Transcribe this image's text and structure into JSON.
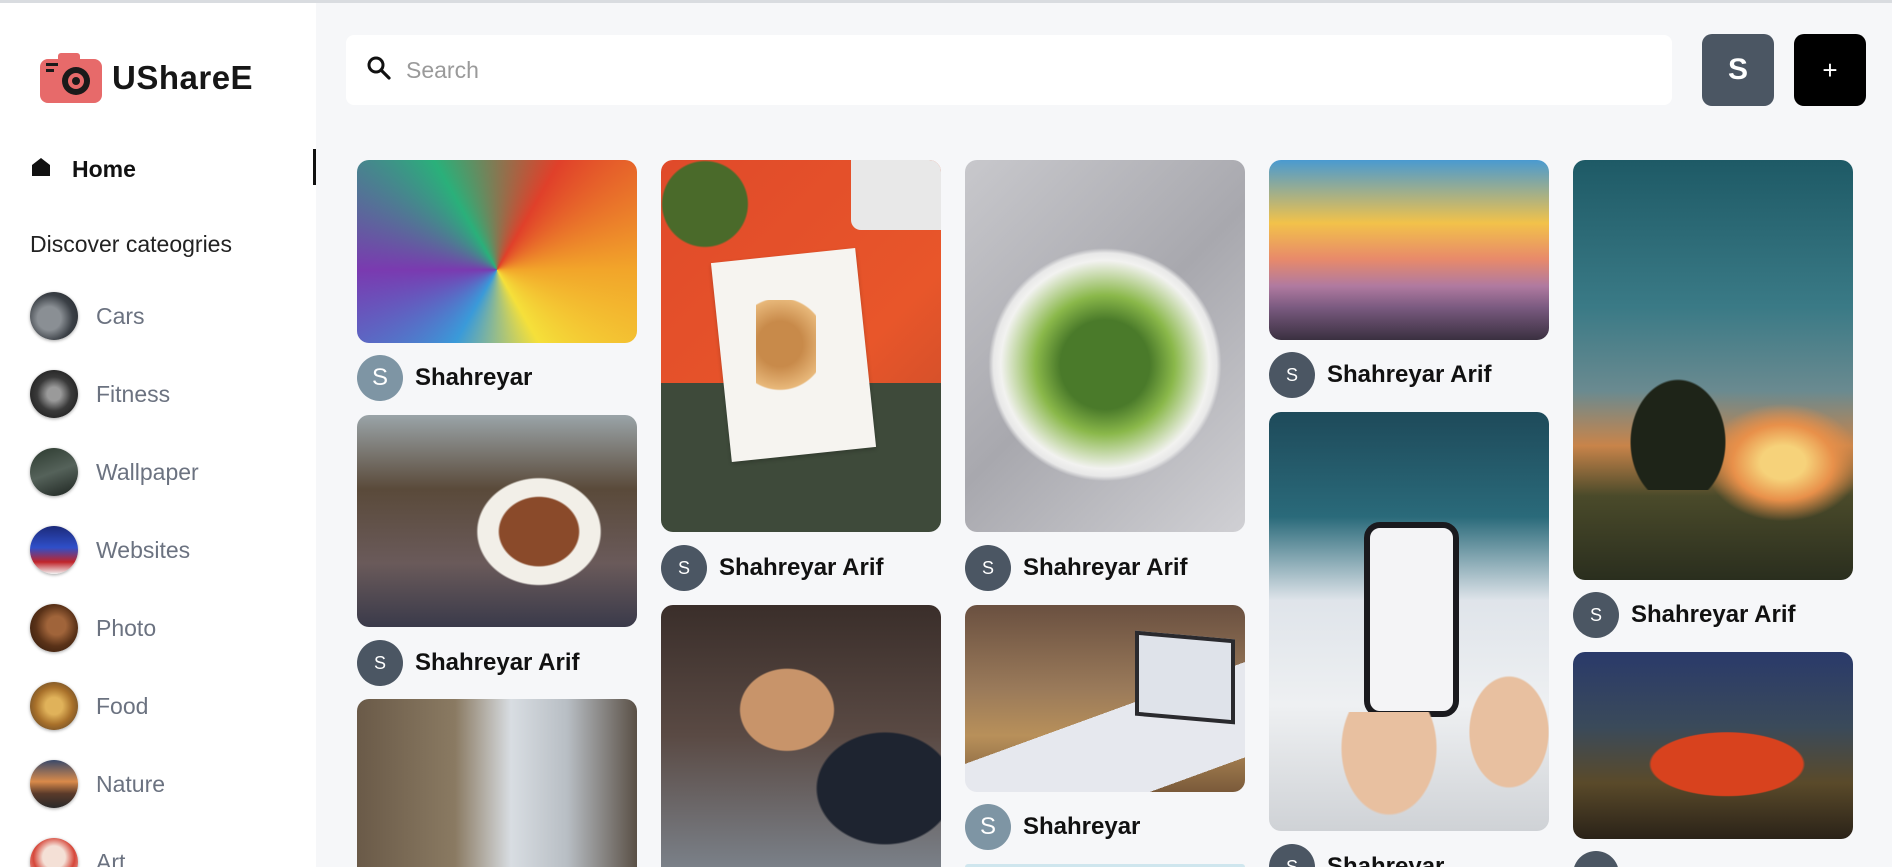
{
  "app": {
    "name": "UShareE"
  },
  "sidebar": {
    "home_label": "Home",
    "discover_label": "Discover cateogries",
    "categories": [
      {
        "label": "Cars"
      },
      {
        "label": "Fitness"
      },
      {
        "label": "Wallpaper"
      },
      {
        "label": "Websites"
      },
      {
        "label": "Photo"
      },
      {
        "label": "Food"
      },
      {
        "label": "Nature"
      },
      {
        "label": "Art"
      }
    ]
  },
  "header": {
    "search_placeholder": "Search",
    "user_initial": "S",
    "add_label": "+"
  },
  "pins": [
    {
      "author_initial": "S",
      "author": "Shahreyar"
    },
    {
      "author_initial": "S",
      "author": "Shahreyar Arif"
    },
    {
      "author_initial": "S",
      "author": "Shahreyar Arif"
    },
    {
      "author_initial": "S",
      "author": "Shahreyar Arif"
    },
    {
      "author_initial": "S",
      "author": "Shahreyar"
    },
    {
      "author_initial": "S",
      "author": "Shahreyar Arif"
    },
    {
      "author_initial": "S",
      "author": "Shahreyar Arif"
    },
    {
      "author_initial": "S",
      "author": "Shahreyar"
    },
    {
      "author_initial": "S",
      "author": ""
    }
  ],
  "colors": {
    "accent_dark": "#4b5663",
    "add_button": "#000000",
    "text_muted": "#6b7280"
  }
}
